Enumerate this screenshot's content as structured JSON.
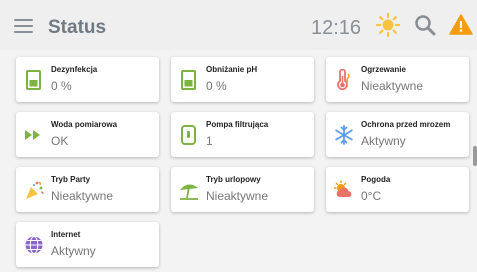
{
  "header": {
    "title": "Status",
    "time": "12:16",
    "icons": [
      "menu-icon",
      "sun-icon",
      "search-icon",
      "warning-icon"
    ]
  },
  "colors": {
    "accent_green": "#7cb342",
    "sun": "#f6c343",
    "warning": "#f39c12",
    "snowflake": "#5d9cec",
    "globe": "#8e63c9",
    "thermo": "#e57368"
  },
  "tiles": [
    {
      "label": "Dezynfekcja",
      "value": "0 %",
      "icon": "tank-icon"
    },
    {
      "label": "Obniżanie pH",
      "value": "0 %",
      "icon": "tank-icon"
    },
    {
      "label": "Ogrzewanie",
      "value": "Nieaktywne",
      "icon": "thermometer-icon"
    },
    {
      "label": "Woda pomiarowa",
      "value": "OK",
      "icon": "flow-arrows-icon"
    },
    {
      "label": "Pompa filtrująca",
      "value": "1",
      "icon": "pump-icon"
    },
    {
      "label": "Ochrona przed mrozem",
      "value": "Aktywny",
      "icon": "snowflake-icon"
    },
    {
      "label": "Tryb Party",
      "value": "Nieaktywne",
      "icon": "party-icon"
    },
    {
      "label": "Tryb urlopowy",
      "value": "Nieaktywne",
      "icon": "umbrella-icon"
    },
    {
      "label": "Pogoda",
      "value": "0°C",
      "icon": "weather-icon"
    },
    {
      "label": "Internet",
      "value": "Aktywny",
      "icon": "globe-icon"
    }
  ]
}
